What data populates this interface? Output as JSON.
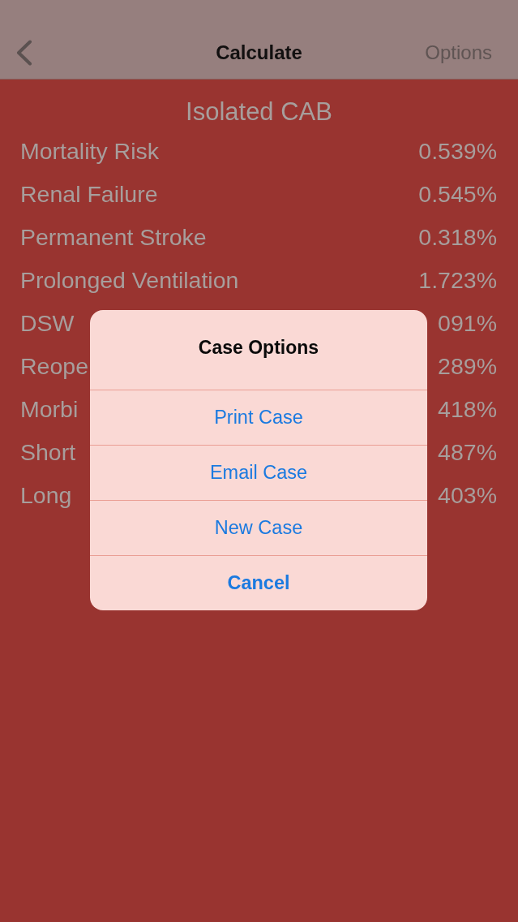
{
  "nav_bar": {
    "title": "Calculate",
    "right_button": "Options"
  },
  "results": {
    "title": "Isolated CAB",
    "rows": [
      {
        "label": "Mortality Risk",
        "value": "0.539%"
      },
      {
        "label": "Renal Failure",
        "value": "0.545%"
      },
      {
        "label": "Permanent Stroke",
        "value": "0.318%"
      },
      {
        "label": "Prolonged Ventilation",
        "value": "1.723%"
      },
      {
        "label": "DSW",
        "value": "091%"
      },
      {
        "label": "Reope",
        "value": "289%"
      },
      {
        "label": "Morbi",
        "value": "418%"
      },
      {
        "label": "Short",
        "value": "487%"
      },
      {
        "label": "Long",
        "value": "403%"
      }
    ]
  },
  "alert": {
    "title": "Case Options",
    "actions": [
      {
        "label": "Print Case",
        "kind": "default"
      },
      {
        "label": "Email Case",
        "kind": "default"
      },
      {
        "label": "New Case",
        "kind": "default"
      },
      {
        "label": "Cancel",
        "kind": "cancel"
      }
    ]
  }
}
